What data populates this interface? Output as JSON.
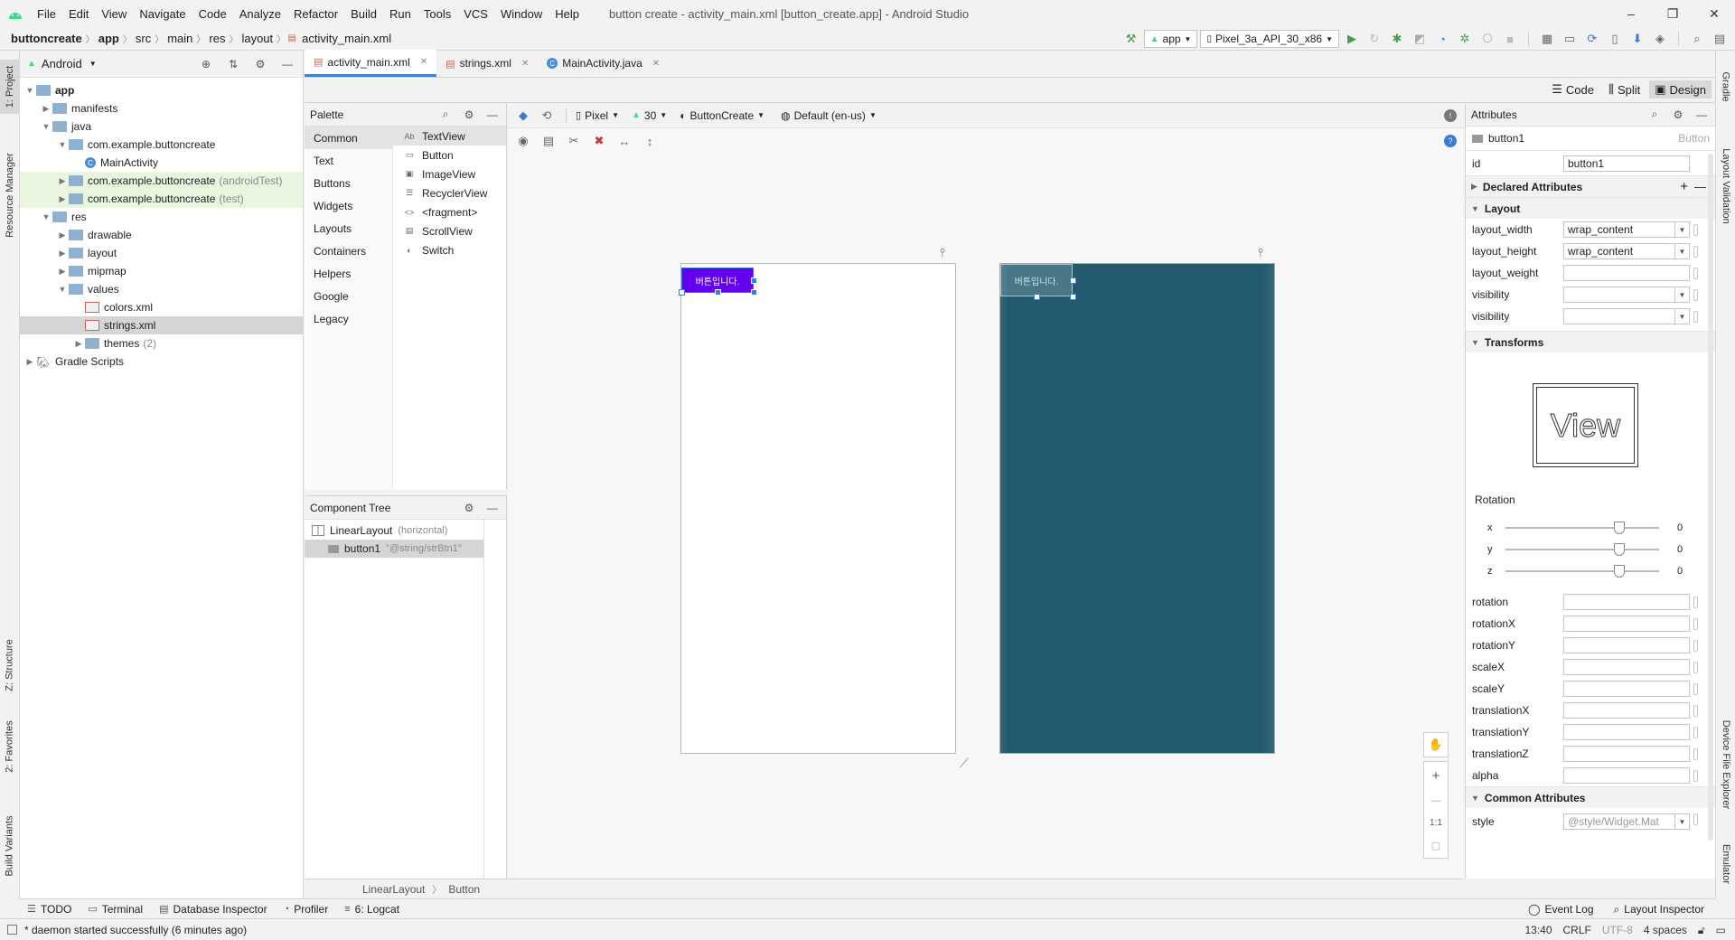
{
  "window": {
    "title": "button create - activity_main.xml [button_create.app] - Android Studio",
    "menu": [
      "File",
      "Edit",
      "View",
      "Navigate",
      "Code",
      "Analyze",
      "Refactor",
      "Build",
      "Run",
      "Tools",
      "VCS",
      "Window",
      "Help"
    ],
    "controls": {
      "minimize": "–",
      "restore": "❐",
      "close": "✕"
    }
  },
  "breadcrumb": [
    "buttoncreate",
    "app",
    "src",
    "main",
    "res",
    "layout",
    "activity_main.xml"
  ],
  "toolbar": {
    "run_config": "app",
    "device": "Pixel_3a_API_30_x86"
  },
  "left_strip": {
    "project": "1: Project",
    "resource_manager": "Resource Manager",
    "structure": "Z: Structure",
    "favorites": "2: Favorites",
    "build_variants": "Build Variants"
  },
  "right_strip": {
    "gradle": "Gradle",
    "layout_validation": "Layout Validation",
    "device_file_explorer": "Device File Explorer",
    "emulator": "Emulator"
  },
  "project": {
    "view": "Android",
    "tree": [
      {
        "label": "app",
        "depth": 0,
        "kind": "folder",
        "open": true,
        "bold": true
      },
      {
        "label": "manifests",
        "depth": 1,
        "kind": "folder"
      },
      {
        "label": "java",
        "depth": 1,
        "kind": "folder",
        "open": true
      },
      {
        "label": "com.example.buttoncreate",
        "depth": 2,
        "kind": "folder",
        "open": true
      },
      {
        "label": "MainActivity",
        "depth": 3,
        "kind": "class"
      },
      {
        "label": "com.example.buttoncreate",
        "suffix": "(androidTest)",
        "depth": 2,
        "kind": "folder",
        "hl": true
      },
      {
        "label": "com.example.buttoncreate",
        "suffix": "(test)",
        "depth": 2,
        "kind": "folder",
        "hl": true
      },
      {
        "label": "res",
        "depth": 1,
        "kind": "folder",
        "open": true
      },
      {
        "label": "drawable",
        "depth": 2,
        "kind": "folder"
      },
      {
        "label": "layout",
        "depth": 2,
        "kind": "folder"
      },
      {
        "label": "mipmap",
        "depth": 2,
        "kind": "folder"
      },
      {
        "label": "values",
        "depth": 2,
        "kind": "folder",
        "open": true
      },
      {
        "label": "colors.xml",
        "depth": 3,
        "kind": "xml"
      },
      {
        "label": "strings.xml",
        "depth": 3,
        "kind": "xml",
        "selected": true
      },
      {
        "label": "themes",
        "suffix": "(2)",
        "depth": 3,
        "kind": "folder"
      },
      {
        "label": "Gradle Scripts",
        "depth": 0,
        "kind": "gradle"
      }
    ]
  },
  "editor_tabs": [
    {
      "label": "activity_main.xml",
      "active": true
    },
    {
      "label": "strings.xml",
      "active": false
    },
    {
      "label": "MainActivity.java",
      "active": false
    }
  ],
  "modes": {
    "code": "Code",
    "split": "Split",
    "design": "Design"
  },
  "palette": {
    "title": "Palette",
    "categories": [
      "Common",
      "Text",
      "Buttons",
      "Widgets",
      "Layouts",
      "Containers",
      "Helpers",
      "Google",
      "Legacy"
    ],
    "items": [
      {
        "icon": "Ab",
        "label": "TextView"
      },
      {
        "icon": "▭",
        "label": "Button"
      },
      {
        "icon": "▣",
        "label": "ImageView"
      },
      {
        "icon": "☰",
        "label": "RecyclerView"
      },
      {
        "icon": "<>",
        "label": "<fragment>"
      },
      {
        "icon": "▤",
        "label": "ScrollView"
      },
      {
        "icon": "◐",
        "label": "Switch"
      }
    ]
  },
  "component_tree": {
    "title": "Component Tree",
    "root": {
      "label": "LinearLayout",
      "detail": "(horizontal)"
    },
    "child": {
      "label": "button1",
      "detail": "\"@string/strBtn1\""
    }
  },
  "surface": {
    "device": "Pixel",
    "api": "30",
    "theme": "ButtonCreate",
    "locale": "Default (en-us)"
  },
  "preview": {
    "button_text": "버튼입니다.",
    "blueprint_text": "버튼입니다."
  },
  "zoom": {
    "plus": "+",
    "minus": "—",
    "fit": "1:1"
  },
  "design_crumbs": [
    "LinearLayout",
    "Button"
  ],
  "attributes": {
    "title": "Attributes",
    "component": "button1",
    "component_type": "Button",
    "id_label": "id",
    "id_value": "button1",
    "declared": "Declared Attributes",
    "layout_section": "Layout",
    "layout_rows": [
      {
        "label": "layout_width",
        "value": "wrap_content",
        "dd": true
      },
      {
        "label": "layout_height",
        "value": "wrap_content",
        "dd": true
      },
      {
        "label": "layout_weight",
        "value": "",
        "dd": false
      },
      {
        "label": "visibility",
        "value": "",
        "dd": true
      },
      {
        "label": "visibility",
        "value": "",
        "dd": true
      }
    ],
    "transforms": "Transforms",
    "view_preview": "View",
    "rotation": "Rotation",
    "axes": [
      {
        "label": "x",
        "value": "0"
      },
      {
        "label": "y",
        "value": "0"
      },
      {
        "label": "z",
        "value": "0"
      }
    ],
    "transform_rows": [
      "rotation",
      "rotationX",
      "rotationY",
      "scaleX",
      "scaleY",
      "translationX",
      "translationY",
      "translationZ",
      "alpha"
    ],
    "common": "Common Attributes",
    "style_label": "style",
    "style_value": "@style/Widget.Mat"
  },
  "bottom_tools": [
    "TODO",
    "Terminal",
    "Database Inspector",
    "Profiler",
    "6: Logcat"
  ],
  "bottom_right": [
    "Event Log",
    "Layout Inspector"
  ],
  "status": {
    "message": "* daemon started successfully (6 minutes ago)",
    "position": "13:40",
    "line_sep": "CRLF",
    "encoding": "UTF-8",
    "indent": "4 spaces"
  },
  "colors": {
    "accent": "#4083c9",
    "button": "#6200ee",
    "blueprint": "#235a6e",
    "run": "#499c54"
  }
}
